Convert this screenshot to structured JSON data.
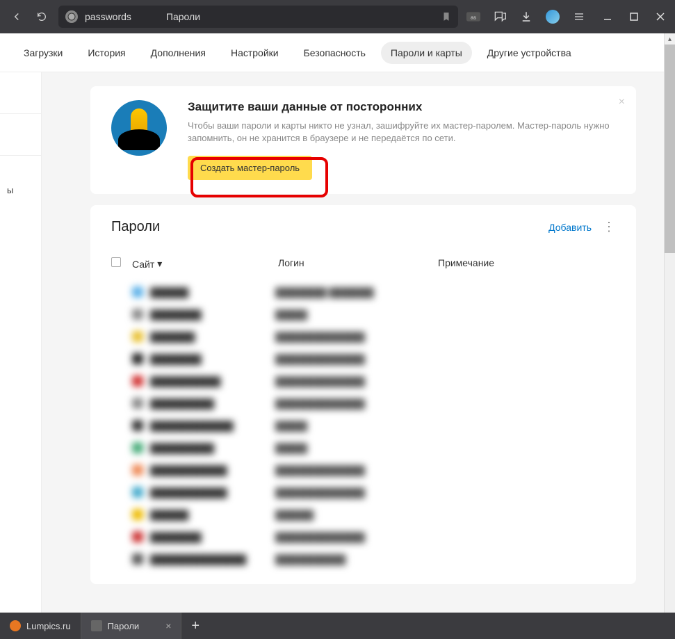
{
  "browser": {
    "url_text": "passwords",
    "page_title": "Пароли"
  },
  "nav": {
    "tabs": [
      "Загрузки",
      "История",
      "Дополнения",
      "Настройки",
      "Безопасность",
      "Пароли и карты",
      "Другие устройства"
    ],
    "active_index": 5
  },
  "sidebar": {
    "item_partial": "ы"
  },
  "promo": {
    "title": "Защитите ваши данные от посторонних",
    "text": "Чтобы ваши пароли и карты никто не узнал, зашифруйте их мастер-паролем. Мастер-пароль нужно запомнить, он не хранится в браузере и не передаётся по сети.",
    "button": "Создать мастер-пароль"
  },
  "passwords": {
    "title": "Пароли",
    "add_label": "Добавить",
    "columns": {
      "site": "Сайт",
      "login": "Логин",
      "note": "Примечание"
    },
    "rows": [
      {
        "color": "#5ab0e8",
        "site": "██████",
        "login": "████████ ███████"
      },
      {
        "color": "#888",
        "site": "████████",
        "login": "█████"
      },
      {
        "color": "#e8c030",
        "site": "███████",
        "login": "██████████████"
      },
      {
        "color": "#222",
        "site": "████████",
        "login": "██████████████"
      },
      {
        "color": "#d03030",
        "site": "███████████",
        "login": "██████████████"
      },
      {
        "color": "#888",
        "site": "██████████",
        "login": "██████████████"
      },
      {
        "color": "#333",
        "site": "█████████████",
        "login": "█████"
      },
      {
        "color": "#4a7",
        "site": "██████████",
        "login": "█████"
      },
      {
        "color": "#e85",
        "site": "████████████",
        "login": "██████████████"
      },
      {
        "color": "#4ac",
        "site": "████████████",
        "login": "██████████████"
      },
      {
        "color": "#eb0",
        "site": "██████",
        "login": "██████"
      },
      {
        "color": "#c33",
        "site": "████████",
        "login": "██████████████"
      },
      {
        "color": "#555",
        "site": "███████████████",
        "login": "███████████"
      }
    ]
  },
  "taskbar": {
    "tabs": [
      {
        "label": "Lumpics.ru",
        "icon_color": "#e87722"
      },
      {
        "label": "Пароли",
        "icon_color": "#ddd"
      }
    ]
  }
}
